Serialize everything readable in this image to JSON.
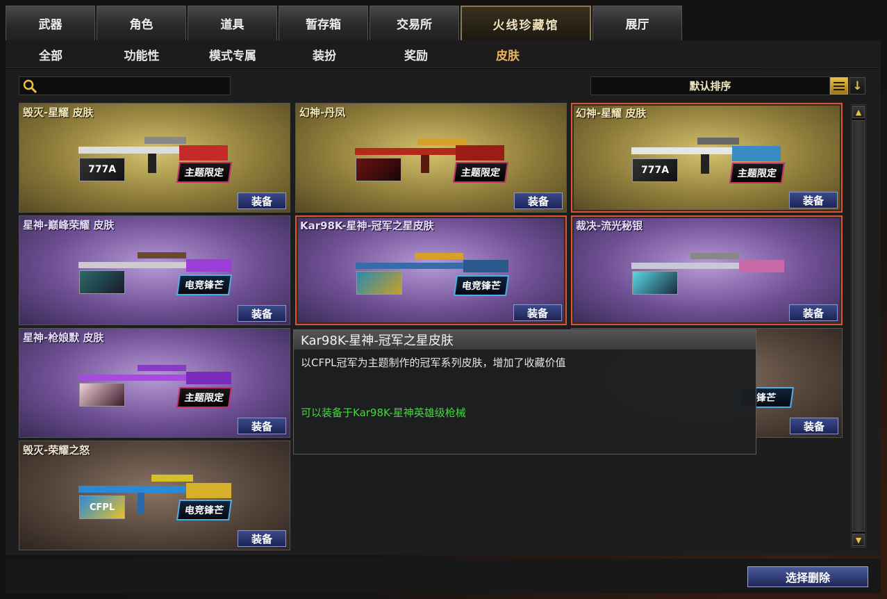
{
  "main_tabs": [
    {
      "label": "武器"
    },
    {
      "label": "角色"
    },
    {
      "label": "道具"
    },
    {
      "label": "暂存箱"
    },
    {
      "label": "交易所"
    },
    {
      "label": "火线珍藏馆"
    },
    {
      "label": "展厅"
    }
  ],
  "sub_tabs": [
    {
      "label": "全部"
    },
    {
      "label": "功能性"
    },
    {
      "label": "模式专属"
    },
    {
      "label": "装扮"
    },
    {
      "label": "奖励"
    },
    {
      "label": "皮肤"
    }
  ],
  "search": {
    "placeholder": ""
  },
  "sort": {
    "label": "默认排序",
    "direction_icon": "↓"
  },
  "equip_label": "装备",
  "items": [
    {
      "title": "毁灭-星耀 皮肤",
      "theme": "gold",
      "badge": "主题限定",
      "thumb_text": "777A"
    },
    {
      "title": "幻神-丹凤",
      "theme": "gold",
      "badge": "主题限定",
      "thumb_text": ""
    },
    {
      "title": "幻神-星耀 皮肤",
      "theme": "gold",
      "badge": "主题限定",
      "thumb_text": "777A"
    },
    {
      "title": "星神-巅峰荣耀 皮肤",
      "theme": "purple",
      "badge": "电竞锋芒",
      "thumb_text": ""
    },
    {
      "title": "Kar98K-星神-冠军之星皮肤",
      "theme": "purple",
      "badge": "电竞锋芒",
      "thumb_text": ""
    },
    {
      "title": "裁决-流光秘银",
      "theme": "purple",
      "badge": "",
      "thumb_text": ""
    },
    {
      "title": "星神-枪娘默 皮肤",
      "theme": "purple",
      "badge": "主题限定",
      "thumb_text": ""
    },
    {
      "title": "",
      "theme": "brown",
      "badge": "锋芒",
      "thumb_text": ""
    },
    {
      "title": "毁灭-荣耀之怒",
      "theme": "brown",
      "badge": "电竞锋芒",
      "thumb_text": "CFPL"
    }
  ],
  "tooltip": {
    "title": "Kar98K-星神-冠军之星皮肤",
    "description": "以CFPL冠军为主题制作的冠军系列皮肤，增加了收藏价值",
    "equip_note": "可以装备于Kar98K-星神英雄级枪械"
  },
  "scroll": {
    "up_icon": "▲",
    "down_icon": "▼"
  },
  "delete_button": "选择删除",
  "colors": {
    "accent_gold": "#f0b55a",
    "equip_blue": "#2c3a78",
    "tooltip_green": "#47d640",
    "selected_border": "#d6563a"
  }
}
